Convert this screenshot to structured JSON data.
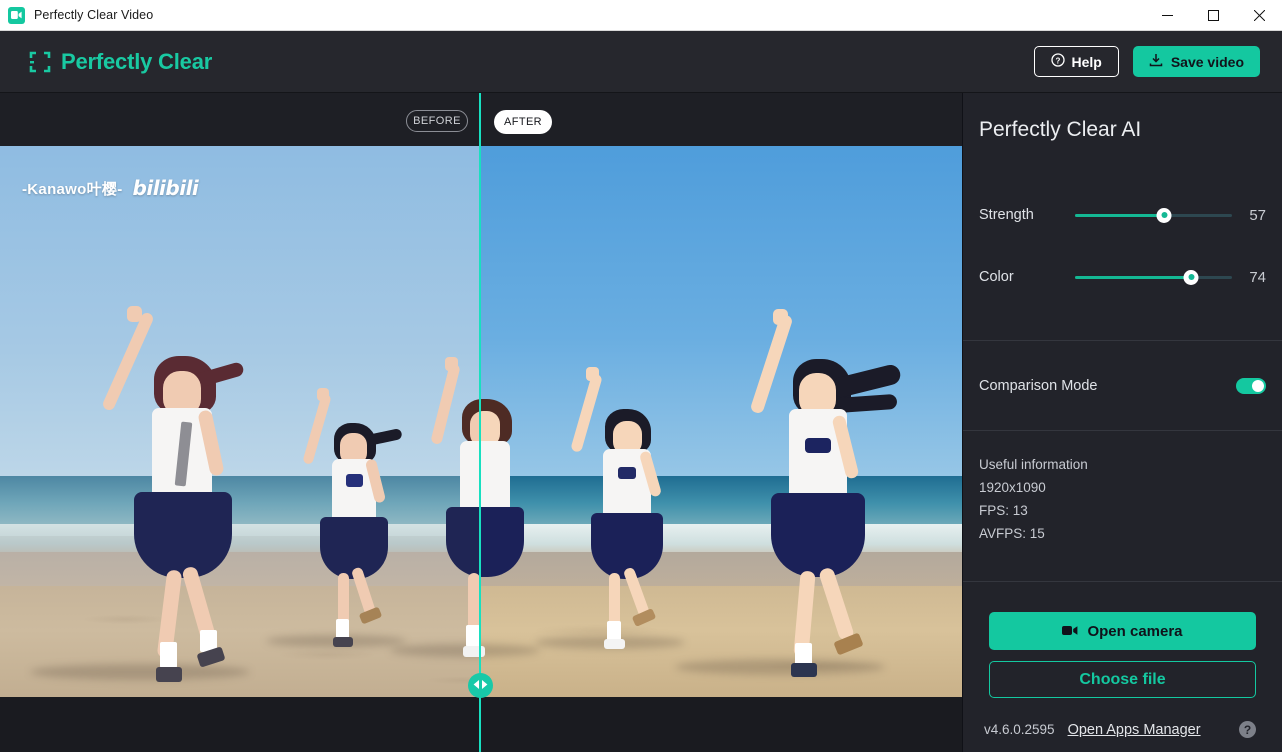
{
  "window": {
    "title": "Perfectly Clear Video",
    "app_icon": "video-camera-icon",
    "minimize_label": "—",
    "maximize_label": "□",
    "close_label": "✕"
  },
  "header": {
    "brand": "Perfectly Clear",
    "brand_mark": "brackets-logo-icon",
    "help_label": "Help",
    "help_icon": "question-circle-icon",
    "save_label": "Save video",
    "save_icon": "download-icon",
    "accent_color": "#14c8a0"
  },
  "viewer": {
    "before_label": "BEFORE",
    "after_label": "AFTER",
    "divider_handle_icon": "left-right-arrows-icon",
    "divider_color": "#18e0c0",
    "watermark_text": "-Kanawo叶樱-",
    "watermark_logo": "bilibili"
  },
  "sidebar": {
    "panel_title": "Perfectly Clear AI",
    "sliders": [
      {
        "label": "Strength",
        "value": 57,
        "percent": 57
      },
      {
        "label": "Color",
        "value": 74,
        "percent": 74
      }
    ],
    "comparison": {
      "label": "Comparison Mode",
      "enabled": true
    },
    "info": {
      "heading": "Useful information",
      "resolution": "1920x1090",
      "fps": "FPS: 13",
      "avfps": "AVFPS: 15"
    },
    "actions": {
      "open_camera_label": "Open camera",
      "open_camera_icon": "video-camera-icon",
      "choose_file_label": "Choose file"
    },
    "footer": {
      "version": "v4.6.0.2595",
      "apps_manager_label": "Open Apps Manager",
      "help_icon_label": "?"
    }
  }
}
